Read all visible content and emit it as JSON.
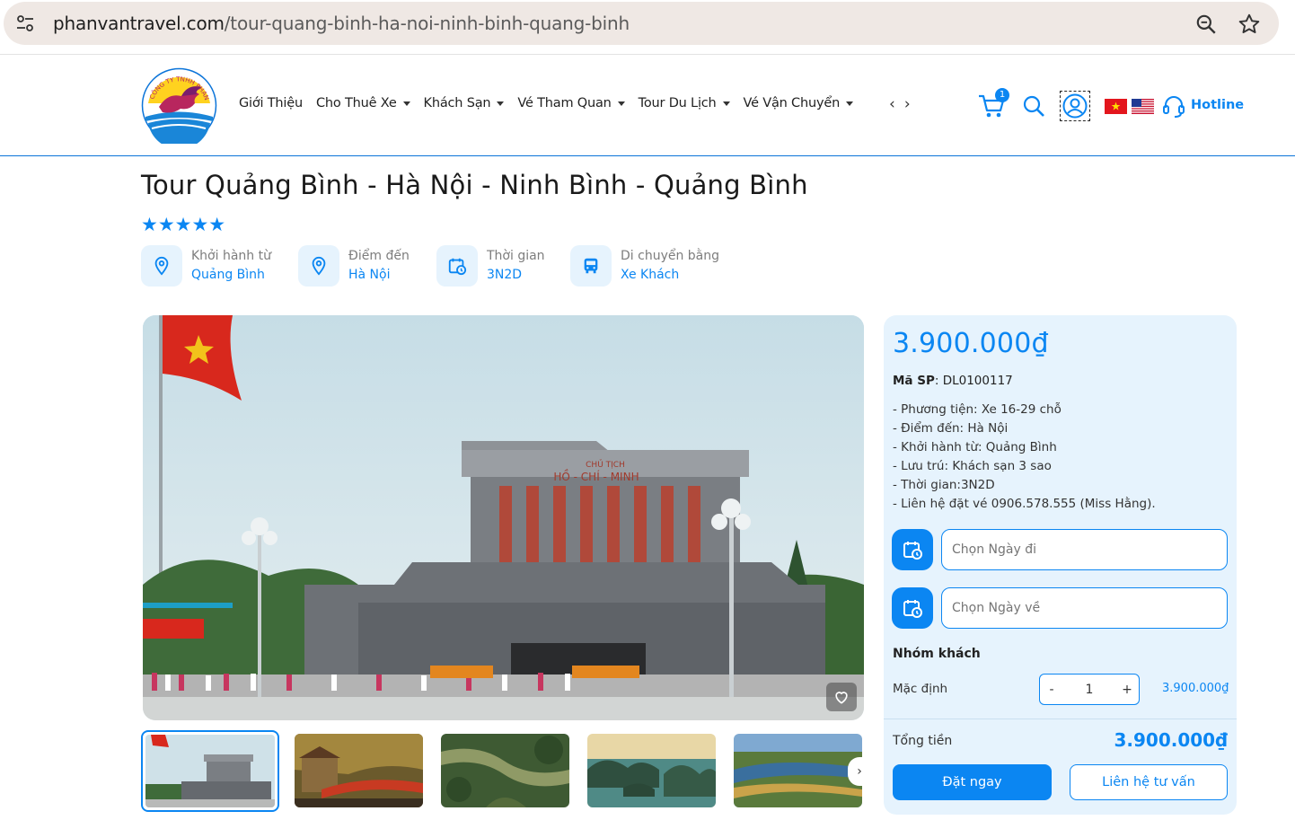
{
  "browser": {
    "url_domain": "phanvantravel.com",
    "url_path": "/tour-quang-binh-ha-noi-ninh-binh-quang-binh"
  },
  "header": {
    "logo_text": "CÔNG TY TNHH PHAN VĂN",
    "nav": [
      {
        "label": "Giới Thiệu",
        "dropdown": false
      },
      {
        "label": "Cho Thuê Xe",
        "dropdown": true
      },
      {
        "label": "Khách Sạn",
        "dropdown": true
      },
      {
        "label": "Vé Tham Quan",
        "dropdown": true
      },
      {
        "label": "Tour Du Lịch",
        "dropdown": true
      },
      {
        "label": "Vé Vận Chuyển",
        "dropdown": true
      }
    ],
    "nav_prev": "‹",
    "nav_next": "›",
    "cart_count": "1",
    "hotline": "Hotline"
  },
  "product": {
    "title": "Tour Quảng Bình - Hà Nội - Ninh Bình - Quảng Bình",
    "stars": "★★★★★",
    "rating": 5,
    "info": [
      {
        "label": "Khởi hành từ",
        "value": "Quảng Bình",
        "icon": "location-pin-icon"
      },
      {
        "label": "Điểm đến",
        "value": "Hà Nội",
        "icon": "location-pin-icon"
      },
      {
        "label": "Thời gian",
        "value": "3N2D",
        "icon": "calendar-clock-icon"
      },
      {
        "label": "Di chuyển bằng",
        "value": "Xe Khách",
        "icon": "bus-icon"
      }
    ],
    "hero_sign_top": "CHỦ TỊCH",
    "hero_sign": "HỒ - CHÍ - MINH"
  },
  "panel": {
    "price": "3.900.000₫",
    "sku_label": "Mã SP",
    "sku_value": ": DL0100117",
    "details": [
      "- Phương tiện: Xe 16-29 chỗ",
      "- Điểm đến: Hà Nội",
      "- Khởi hành từ: Quảng Bình",
      "- Lưu trú: Khách sạn 3 sao",
      "- Thời gian:3N2D",
      "- Liên hệ đặt vé 0906.578.555 (Miss Hằng)."
    ],
    "depart_placeholder": "Chọn Ngày đi",
    "return_placeholder": "Chọn Ngày về",
    "group_title": "Nhóm khách",
    "group_label": "Mặc định",
    "minus": "-",
    "qty": "1",
    "plus": "+",
    "group_price": "3.900.000₫",
    "total_label": "Tổng tiền",
    "total_value": "3.900.000₫",
    "book_label": "Đặt ngay",
    "contact_label": "Liên hệ tư vấn"
  },
  "colors": {
    "accent": "#0b86f2",
    "panel_bg": "#e6f3fd"
  }
}
